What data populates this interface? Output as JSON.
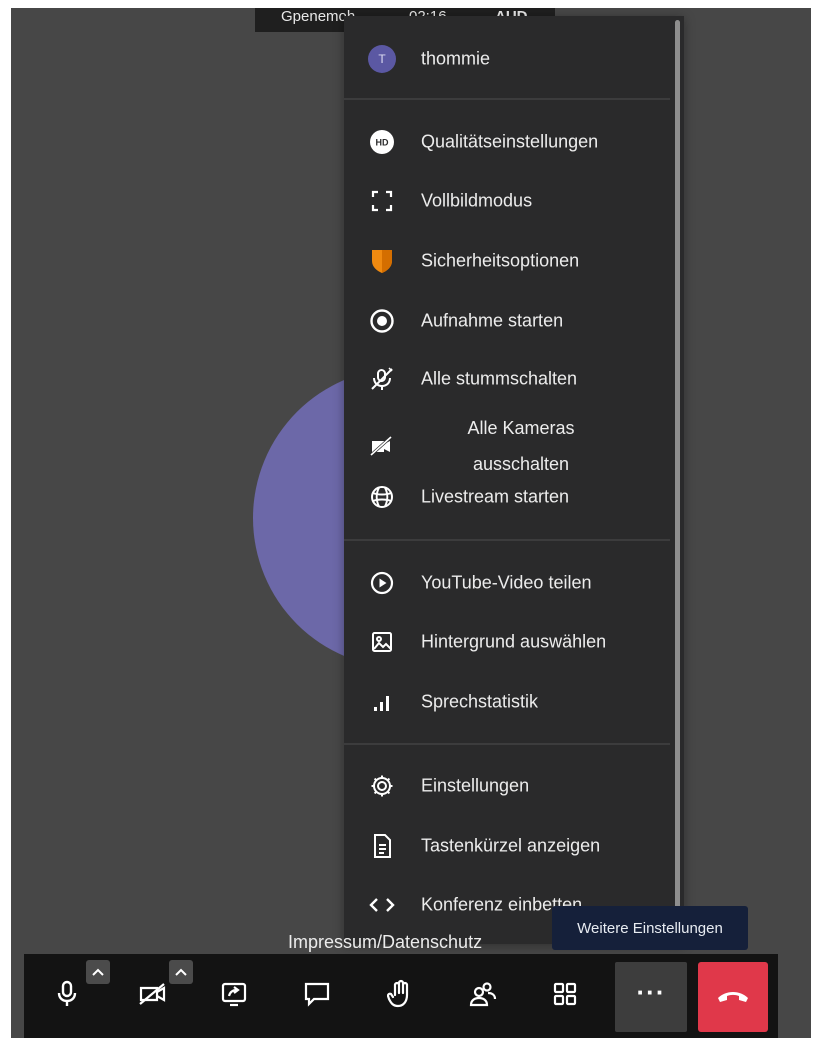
{
  "conference_header": {
    "name": "Gpenemoh",
    "time": "02:16",
    "badge": "AUD"
  },
  "user": {
    "initial": "T",
    "name": "thommie"
  },
  "menu": {
    "items": [
      {
        "id": "quality",
        "label": "Qualitätseinstellungen",
        "icon": "hd-icon"
      },
      {
        "id": "fullscreen",
        "label": "Vollbildmodus",
        "icon": "fullscreen-icon"
      },
      {
        "id": "security",
        "label": "Sicherheitsoptionen",
        "icon": "shield-icon"
      },
      {
        "id": "record",
        "label": "Aufnahme starten",
        "icon": "record-icon"
      },
      {
        "id": "mute-all",
        "label": "Alle stummschalten",
        "icon": "mic-off-icon"
      },
      {
        "id": "cameras-off",
        "label": "Alle Kameras ausschalten",
        "icon": "camera-off-icon"
      },
      {
        "id": "livestream",
        "label": "Livestream starten",
        "icon": "globe-icon"
      },
      {
        "id": "youtube",
        "label": "YouTube-Video teilen",
        "icon": "play-circle-icon"
      },
      {
        "id": "background",
        "label": "Hintergrund auswählen",
        "icon": "image-icon"
      },
      {
        "id": "speakerstats",
        "label": "Sprechstatistik",
        "icon": "bar-chart-icon"
      },
      {
        "id": "settings",
        "label": "Einstellungen",
        "icon": "gear-icon"
      },
      {
        "id": "shortcuts",
        "label": "Tastenkürzel anzeigen",
        "icon": "document-icon"
      },
      {
        "id": "embed",
        "label": "Konferenz einbetten",
        "icon": "code-icon"
      }
    ]
  },
  "footer": {
    "link": "Impressum/Datenschutz"
  },
  "tooltip": {
    "text": "Weitere Einstellungen"
  },
  "toolbar": {
    "buttons": [
      "microphone-icon",
      "camera-off-icon",
      "screen-share-icon",
      "chat-icon",
      "raise-hand-icon",
      "participants-icon",
      "tile-view-icon",
      "more-icon",
      "hangup-icon"
    ]
  },
  "colors": {
    "stage_bg": "#474747",
    "menu_bg": "#2a2a2b",
    "avatar_circle": "#6c68a8",
    "shield": "#f08a10",
    "hangup": "#e0384a",
    "tooltip_bg": "#15203a"
  }
}
